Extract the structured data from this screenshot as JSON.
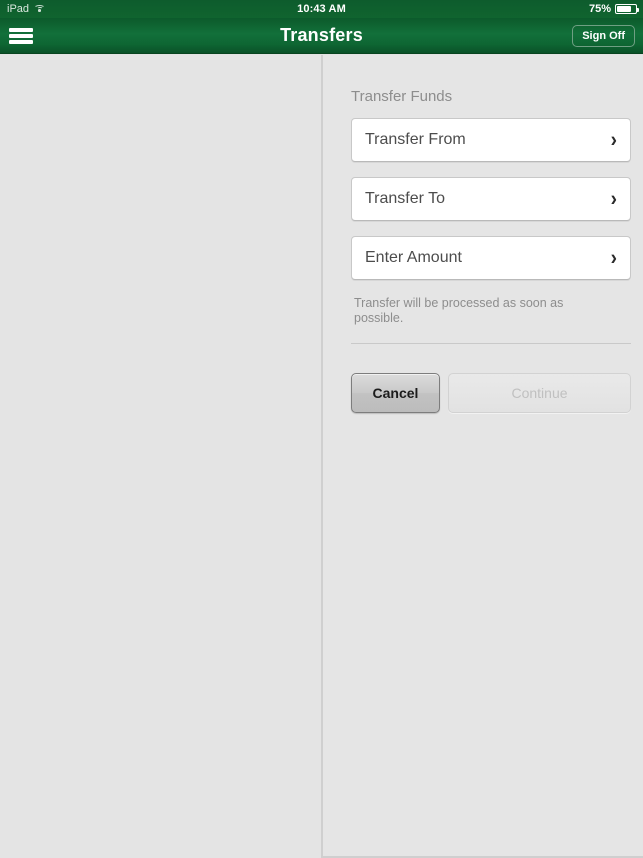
{
  "statusbar": {
    "device": "iPad",
    "wifi_icon": "wifi-icon",
    "time": "10:43 AM",
    "battery_percent": "75%",
    "battery_icon": "battery-icon"
  },
  "navbar": {
    "menu_icon": "hamburger-menu-icon",
    "title": "Transfers",
    "signoff_label": "Sign Off"
  },
  "main": {
    "section_title": "Transfer Funds",
    "rows": [
      {
        "label": "Transfer From",
        "chevron": "›"
      },
      {
        "label": "Transfer To",
        "chevron": "›"
      },
      {
        "label": "Enter Amount",
        "chevron": "›"
      }
    ],
    "note": "Transfer will be processed as soon as possible.",
    "cancel_label": "Cancel",
    "continue_label": "Continue"
  },
  "colors": {
    "brand_green": "#0e6633",
    "panel_gray": "#e5e5e5",
    "text_gray": "#8d8d8d"
  }
}
